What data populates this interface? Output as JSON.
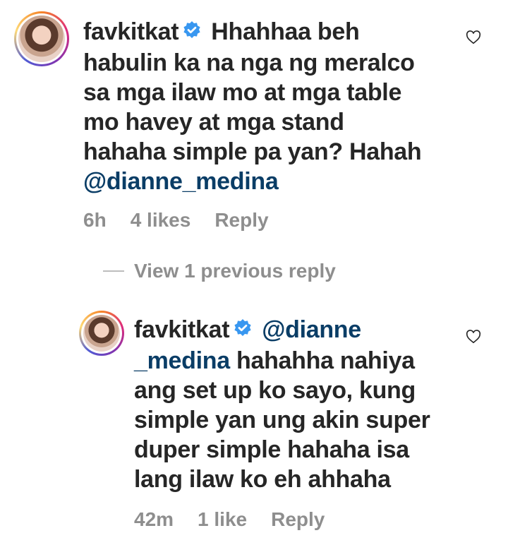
{
  "comments": [
    {
      "username": "favkitkat",
      "text_lines": [
        "Hhahhaa beh",
        "habulin ka na nga ng meralco",
        "sa mga ilaw mo at mga table",
        "mo havey at mga stand",
        "hahaha simple pa yan? Hahah"
      ],
      "mention": "@dianne_medina",
      "time": "6h",
      "likes": "4 likes",
      "reply_label": "Reply"
    },
    {
      "username": "favkitkat",
      "mention_part1": "@dianne",
      "mention_part2": "_medina",
      "text_after_mention": "hahahha nahiya",
      "text_lines": [
        "ang set up ko sayo, kung",
        "simple yan ung akin super",
        "duper simple hahaha isa",
        "lang ilaw ko eh ahhaha"
      ],
      "time": "42m",
      "likes": "1 like",
      "reply_label": "Reply"
    }
  ],
  "view_replies_label": "View 1 previous reply",
  "colors": {
    "verified": "#3897f0",
    "mention": "#0a3d66",
    "meta": "#8e8e8e",
    "text": "#262626"
  },
  "icons": [
    "verified-badge-icon",
    "heart-icon"
  ]
}
